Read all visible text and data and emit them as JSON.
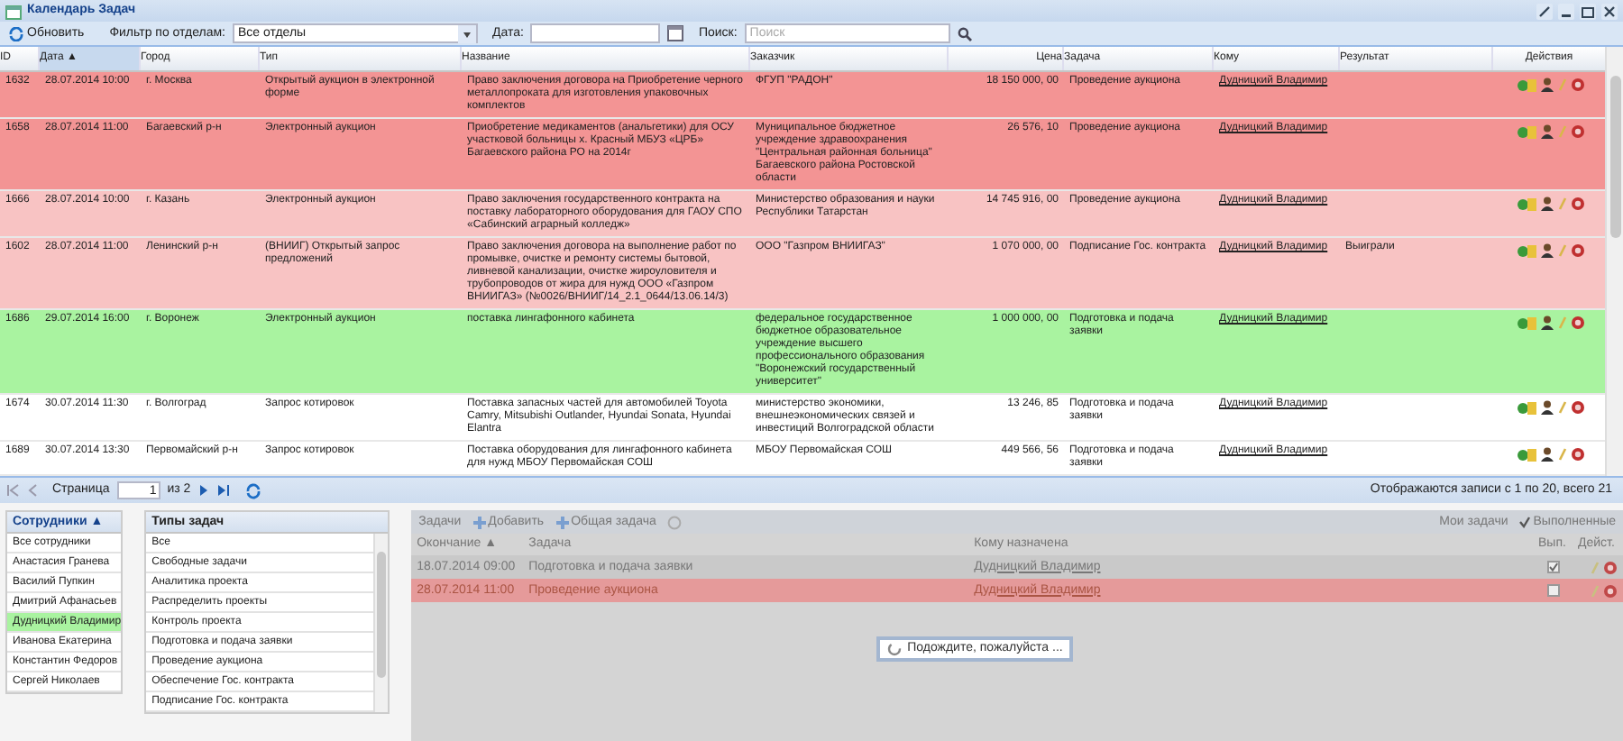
{
  "window": {
    "title": "Календарь Задач"
  },
  "toolbar": {
    "refresh": "Обновить",
    "filter_label": "Фильтр по отделам:",
    "filter_value": "Все отделы",
    "date_label": "Дата:",
    "search_label": "Поиск:",
    "search_placeholder": "Поиск"
  },
  "table": {
    "columns": [
      "ID",
      "Дата ▲",
      "Город",
      "Тип",
      "Название",
      "Заказчик",
      "Цена",
      "Задача",
      "Кому",
      "Результат",
      "Действия"
    ],
    "rows": [
      {
        "color": "#f39494",
        "cells": [
          "1632",
          "28.07.2014 10:00",
          "г. Москва",
          "Открытый аукцион в электронной форме",
          "Право заключения договора на Приобретение черного металлопроката для изготовления упаковочных комплектов",
          "ФГУП \"РАДОН\"",
          "18 150 000, 00",
          "Проведение аукциона",
          "Дудницкий Владимир",
          ""
        ]
      },
      {
        "color": "#f39494",
        "cells": [
          "1658",
          "28.07.2014 11:00",
          "Багаевский р-н",
          "Электронный аукцион",
          "Приобретение медикаментов (анальгетики) для ОСУ участковой больницы х. Красный МБУЗ «ЦРБ» Багаевского района РО на 2014г",
          "Муниципальное бюджетное учреждение здравоохранения \"Центральная районная больница\" Багаевского района Ростовской области",
          "26 576, 10",
          "Проведение аукциона",
          "Дудницкий Владимир",
          ""
        ]
      },
      {
        "color": "#f8c3c3",
        "cells": [
          "1666",
          "28.07.2014 10:00",
          "г. Казань",
          "Электронный аукцион",
          "Право заключения государственного контракта на поставку лабораторного оборудования для ГАОУ СПО «Сабинский аграрный колледж»",
          "Министерство образования и науки Республики Татарстан",
          "14 745 916, 00",
          "Проведение аукциона",
          "Дудницкий Владимир",
          ""
        ]
      },
      {
        "color": "#f8c3c3",
        "cells": [
          "1602",
          "28.07.2014 11:00",
          "Ленинский р-н",
          "(ВНИИГ) Открытый запрос предложений",
          "Право заключения договора на выполнение работ по промывке, очистке и ремонту системы бытовой, ливневой канализации, очистке жироуловителя и трубопроводов от жира для нужд ООО «Газпром ВНИИГАЗ» (№0026/ВНИИГ/14_2.1_0644/13.06.14/3)",
          "ООО \"Газпром ВНИИГАЗ\"",
          "1 070 000, 00",
          "Подписание Гос. контракта",
          "Дудницкий Владимир",
          "Выиграли"
        ]
      },
      {
        "color": "#a9f3a0",
        "cells": [
          "1686",
          "29.07.2014 16:00",
          "г. Воронеж",
          "Электронный аукцион",
          "поставка лингафонного кабинета",
          "федеральное государственное бюджетное образовательное учреждение высшего профессионального образования \"Воронежский государственный университет\"",
          "1 000 000, 00",
          "Подготовка и подача заявки",
          "Дудницкий Владимир",
          ""
        ]
      },
      {
        "color": "#ffffff",
        "cells": [
          "1674",
          "30.07.2014 11:30",
          "г. Волгоград",
          "Запрос котировок",
          "Поставка запасных частей для автомобилей Toyota Camry, Mitsubishi Outlander, Hyundai Sonata, Hyundai Elantra",
          "министерство экономики, внешнеэкономических связей и инвестиций Волгоградской области",
          "13 246, 85",
          "Подготовка и подача заявки",
          "Дудницкий Владимир",
          ""
        ]
      },
      {
        "color": "#ffffff",
        "cells": [
          "1689",
          "30.07.2014 13:30",
          "Первомайский р-н",
          "Запрос котировок",
          "Поставка оборудования для лингафонного кабинета для нужд МБОУ Первомайская СОШ",
          "МБОУ Первомайская СОШ",
          "449 566, 56",
          "Подготовка и подача заявки",
          "Дудницкий Владимир",
          ""
        ]
      }
    ]
  },
  "pager": {
    "page_label": "Страница",
    "page": "1",
    "of": "из 2",
    "summary": "Отображаются записи с 1 по 20, всего 21"
  },
  "employees": {
    "header": "Сотрудники ▲",
    "items": [
      {
        "label": "Все сотрудники",
        "selected": false
      },
      {
        "label": "Анастасия Гранева",
        "selected": false
      },
      {
        "label": "Василий Пупкин",
        "selected": false
      },
      {
        "label": "Дмитрий Афанасьев",
        "selected": false
      },
      {
        "label": "Дудницкий Владимир",
        "selected": true
      },
      {
        "label": "Иванова Екатерина",
        "selected": false
      },
      {
        "label": "Константин Федоров",
        "selected": false
      },
      {
        "label": "Сергей Николаев",
        "selected": false
      }
    ]
  },
  "task_types": {
    "header": "Типы задач",
    "items": [
      {
        "label": "Все",
        "selected": false
      },
      {
        "label": "Свободные задачи",
        "selected": false
      },
      {
        "label": "Аналитика проекта",
        "selected": false
      },
      {
        "label": "Распределить проекты",
        "selected": false
      },
      {
        "label": "Контроль проекта",
        "selected": false
      },
      {
        "label": "Подготовка и подача заявки",
        "selected": false
      },
      {
        "label": "Проведение аукциона",
        "selected": false
      },
      {
        "label": "Обеспечение Гос. контракта",
        "selected": false
      },
      {
        "label": "Подписание Гос. контракта",
        "selected": false
      }
    ]
  },
  "tasks": {
    "title": "Задачи",
    "add": "Добавить",
    "common": "Общая задача",
    "my_tasks": "Мои задачи",
    "completed": "Выполненные",
    "completed_checked": true,
    "columns": [
      "Окончание ▲",
      "Задача",
      "Кому назначена",
      "Вып.",
      "Дейст."
    ],
    "rows": [
      {
        "color": "#c9c9c9",
        "end": "18.07.2014 09:00",
        "task": "Подготовка и подача заявки",
        "assignee": "Дудницкий Владимир",
        "done": true
      },
      {
        "color": "#e59a9a",
        "end": "28.07.2014 11:00",
        "task": "Проведение аукциона",
        "assignee": "Дудницкий Владимир",
        "done": false
      }
    ],
    "loading": "Подождите, пожалуйста ..."
  }
}
